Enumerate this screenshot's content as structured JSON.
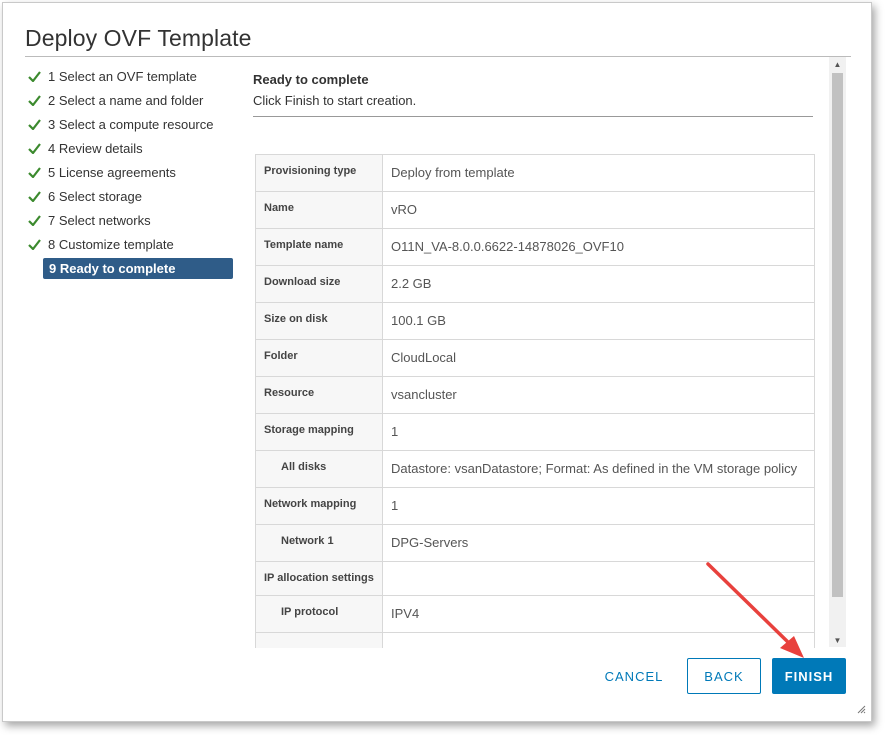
{
  "window": {
    "title": "Deploy OVF Template"
  },
  "steps": [
    {
      "label": "1 Select an OVF template",
      "done": true
    },
    {
      "label": "2 Select a name and folder",
      "done": true
    },
    {
      "label": "3 Select a compute resource",
      "done": true
    },
    {
      "label": "4 Review details",
      "done": true
    },
    {
      "label": "5 License agreements",
      "done": true
    },
    {
      "label": "6 Select storage",
      "done": true
    },
    {
      "label": "7 Select networks",
      "done": true
    },
    {
      "label": "8 Customize template",
      "done": true
    },
    {
      "label": "9 Ready to complete",
      "active": true
    }
  ],
  "content": {
    "title": "Ready to complete",
    "subtitle": "Click Finish to start creation."
  },
  "summary": [
    {
      "label": "Provisioning type",
      "value": "Deploy from template"
    },
    {
      "label": "Name",
      "value": "vRO"
    },
    {
      "label": "Template name",
      "value": "O11N_VA-8.0.0.6622-14878026_OVF10"
    },
    {
      "label": "Download size",
      "value": "2.2 GB"
    },
    {
      "label": "Size on disk",
      "value": "100.1 GB"
    },
    {
      "label": "Folder",
      "value": "CloudLocal"
    },
    {
      "label": "Resource",
      "value": "vsancluster"
    },
    {
      "label": "Storage mapping",
      "value": "1"
    },
    {
      "label": "All disks",
      "value": "Datastore: vsanDatastore; Format: As defined in the VM storage policy"
    },
    {
      "label": "Network mapping",
      "value": "1"
    },
    {
      "label": "Network 1",
      "value": "DPG-Servers"
    },
    {
      "label": "IP allocation settings",
      "value": ""
    },
    {
      "label": "IP protocol",
      "value": "IPV4"
    },
    {
      "label": "",
      "value": ""
    }
  ],
  "buttons": {
    "cancel": "CANCEL",
    "back": "BACK",
    "finish": "FINISH"
  },
  "colors": {
    "accent": "#0079b8",
    "active_step": "#2f5c88",
    "check": "#3c8a2e",
    "arrow": "#e8413d"
  }
}
